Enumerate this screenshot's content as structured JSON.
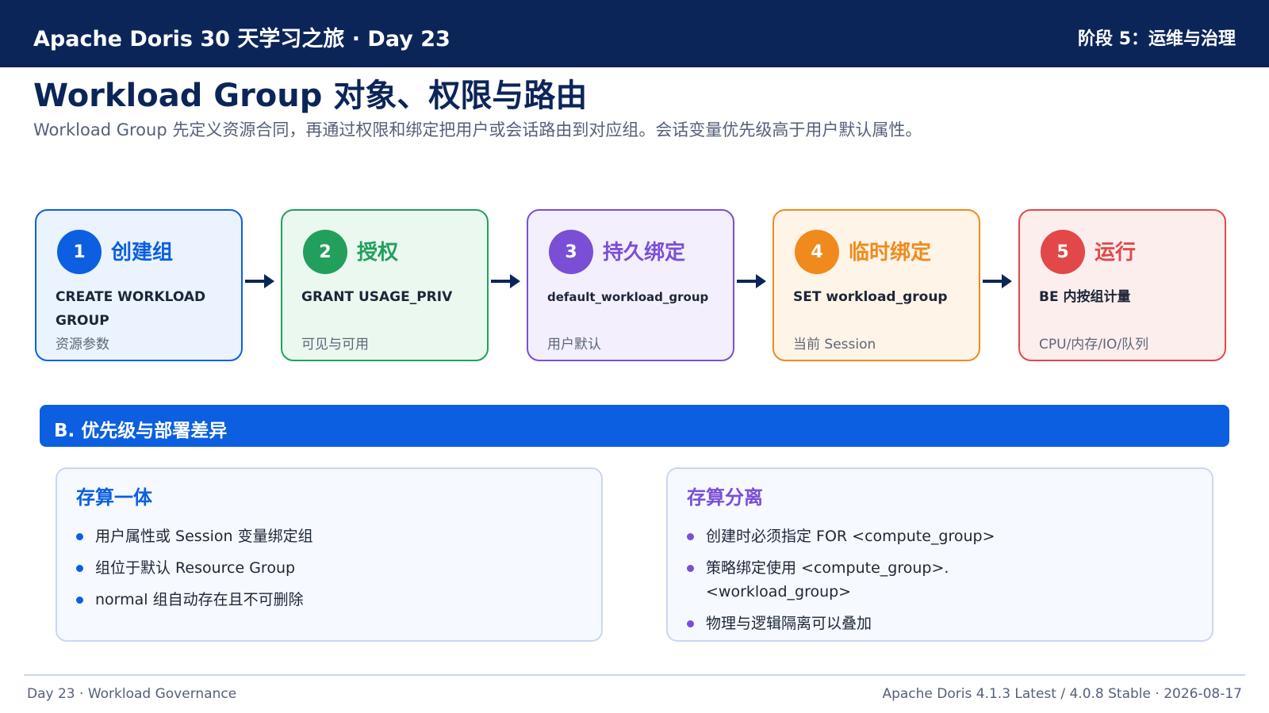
{
  "header": {
    "brand": "Apache Doris 30 天学习之旅 · Day 23",
    "stage": "阶段 5：运维与治理"
  },
  "title": "Workload Group 对象、权限与路由",
  "subtitle": "Workload Group 先定义资源合同，再通过权限和绑定把用户或会话路由到对应组。会话变量优先级高于用户默认属性。",
  "steps": [
    {
      "num": "1",
      "name": "创建组",
      "cmd": "CREATE WORKLOAD GROUP",
      "note": "资源参数",
      "color": "#0b5fe0",
      "bg": "#eaf3fe"
    },
    {
      "num": "2",
      "name": "授权",
      "cmd": "GRANT USAGE_PRIV",
      "note": "可见与可用",
      "color": "#22a05b",
      "bg": "#eaf8ef"
    },
    {
      "num": "3",
      "name": "持久绑定",
      "cmd": "default_workload_group",
      "note": "用户默认",
      "color": "#7a4fd6",
      "bg": "#f3effd"
    },
    {
      "num": "4",
      "name": "临时绑定",
      "cmd": "SET workload_group",
      "note": "当前 Session",
      "color": "#f08a1c",
      "bg": "#fff4e8"
    },
    {
      "num": "5",
      "name": "运行",
      "cmd": "BE 内按组计量",
      "note": "CPU/内存/IO/队列",
      "color": "#e24848",
      "bg": "#fdeeee"
    }
  ],
  "section_b": {
    "label": "B. 优先级与部署差异"
  },
  "panels": {
    "integrated": {
      "title": "存算一体",
      "color": "#0b5fe0",
      "items": [
        "用户属性或 Session 变量绑定组",
        "组位于默认 Resource Group",
        "normal 组自动存在且不可删除"
      ]
    },
    "decoupled": {
      "title": "存算分离",
      "color": "#7a4fd6",
      "items": [
        "创建时必须指定 FOR <compute_group>",
        "策略绑定使用 <compute_group>.<workload_group>",
        "物理与逻辑隔离可以叠加"
      ]
    }
  },
  "footer": {
    "left": "Day 23 · Workload Governance",
    "right": "Apache Doris 4.1.3 Latest / 4.0.8 Stable · 2026-08-17"
  },
  "colors": {
    "navy": "#0c2559",
    "accent": "#0b5fe0"
  },
  "icons": {
    "arrow": "arrow-right-icon",
    "bullet": "bullet-dot-icon"
  }
}
